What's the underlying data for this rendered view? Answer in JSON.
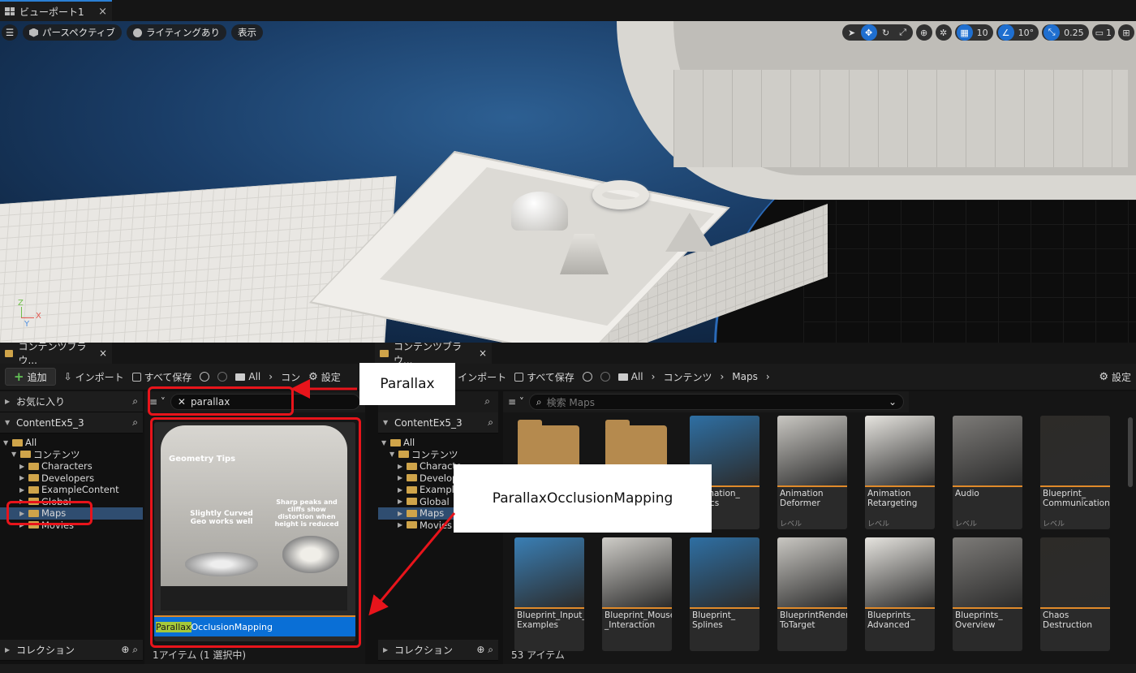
{
  "viewport": {
    "tab_title": "ビューポート1",
    "perspective_label": "パースペクティブ",
    "lighting_label": "ライティングあり",
    "show_label": "表示",
    "grid_snap_value": "10",
    "angle_snap_value": "10°",
    "scale_snap_value": "0.25",
    "camera_speed_value": "1",
    "axis": {
      "z": "Z",
      "x": "X",
      "y": "Y"
    }
  },
  "left_browser": {
    "tab_title": "コンテンツブラウ...",
    "add_label": "追加",
    "import_label": "インポート",
    "save_all_label": "すべて保存",
    "breadcrumb_all": "All",
    "breadcrumb_content": "コン",
    "settings_label": "設定",
    "favorites_label": "お気に入り",
    "project_label": "ContentEx5_3",
    "tree": [
      {
        "label": "All",
        "indent": 0
      },
      {
        "label": "コンテンツ",
        "indent": 1
      },
      {
        "label": "Characters",
        "indent": 2
      },
      {
        "label": "Developers",
        "indent": 2
      },
      {
        "label": "ExampleContent",
        "indent": 2
      },
      {
        "label": "Global",
        "indent": 2
      },
      {
        "label": "Maps",
        "indent": 2
      },
      {
        "label": "Movies",
        "indent": 2
      }
    ],
    "search_value": "parallax",
    "asset": {
      "highlight": "Parallax",
      "rest": "OcclusionMapping",
      "preview_title": "Geometry Tips",
      "preview_text1": "Slightly Curved Geo works well",
      "preview_text2": "Sharp peaks and cliffs show distortion when height is reduced"
    },
    "collections_label": "コレクション",
    "footer": "1アイテム (1 選択中)"
  },
  "right_browser": {
    "tab_title": "コンテンツブラウ...",
    "import_label": "インポート",
    "save_all_label": "すべて保存",
    "breadcrumb": [
      "All",
      "コンテンツ",
      "Maps"
    ],
    "settings_label": "設定",
    "project_label": "ContentEx5_3",
    "tree": [
      {
        "label": "All",
        "indent": 0
      },
      {
        "label": "コンテンツ",
        "indent": 1
      },
      {
        "label": "Characte",
        "indent": 2
      },
      {
        "label": "Develop",
        "indent": 2
      },
      {
        "label": "Example",
        "indent": 2
      },
      {
        "label": "Global",
        "indent": 2
      },
      {
        "label": "Maps",
        "indent": 2
      },
      {
        "label": "Movies",
        "indent": 2
      }
    ],
    "search_placeholder": "検索 Maps",
    "assets_row1": [
      {
        "name": "",
        "type": ""
      },
      {
        "name": "",
        "type": ""
      },
      {
        "name": "Animation_\nBasics",
        "type": ""
      },
      {
        "name": "Animation\nDeformer",
        "type": "レベル"
      },
      {
        "name": "Animation\nRetargeting",
        "type": "レベル"
      },
      {
        "name": "Audio",
        "type": "レベル"
      },
      {
        "name": "Blueprint_\nCommunication",
        "type": "レベル"
      }
    ],
    "assets_row2": [
      {
        "name": "Blueprint_Input_\nExamples",
        "type": ""
      },
      {
        "name": "Blueprint_Mouse\n_Interaction",
        "type": ""
      },
      {
        "name": "Blueprint_\nSplines",
        "type": ""
      },
      {
        "name": "BlueprintRender\nToTarget",
        "type": ""
      },
      {
        "name": "Blueprints_\nAdvanced",
        "type": ""
      },
      {
        "name": "Blueprints_\nOverview",
        "type": ""
      },
      {
        "name": "Chaos\nDestruction",
        "type": ""
      }
    ],
    "collections_label": "コレクション",
    "footer": "53 アイテム"
  },
  "annotations": {
    "callout1": "Parallax",
    "callout2": "ParallaxOcclusionMapping"
  },
  "colors": {
    "accent_blue": "#1f6fd0",
    "selection": "#0a6fd6",
    "annotation_red": "#e8141b",
    "folder": "#cfa44a"
  }
}
